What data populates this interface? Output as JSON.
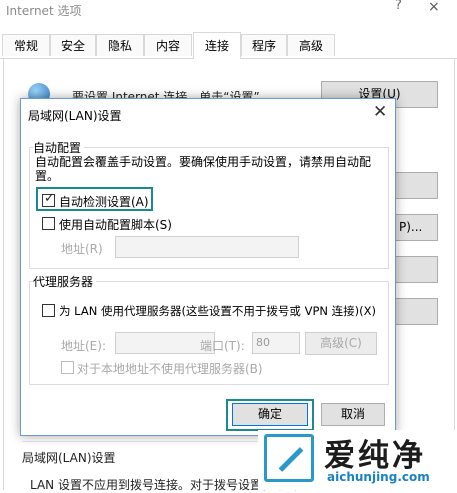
{
  "background": {
    "title": "Internet 选项",
    "help_glyph": "?",
    "close_glyph": "×",
    "tabs": [
      "常规",
      "安全",
      "隐私",
      "内容",
      "连接",
      "程序",
      "高级"
    ],
    "active_tab": "连接",
    "setup_text": "要设置 Internet 连接，单击“设置”。",
    "setup_button": "设置(U)",
    "side_buttons": [
      "",
      "",
      "P)...",
      "",
      ""
    ],
    "lan_section_label": "局域网(LAN)设置",
    "lan_section_desc": "LAN 设置不应用到拨号连接。对于拨号设置，单击"
  },
  "dialog": {
    "title": "局域网(LAN)设置",
    "close_glyph": "✕",
    "auto_config": {
      "group_label": "自动配置",
      "description": "自动配置会覆盖手动设置。要确保使用手动设置，请禁用自动配置。",
      "auto_detect": {
        "label": "自动检测设置(A)",
        "checked": true
      },
      "use_script": {
        "label": "使用自动配置脚本(S)",
        "checked": false
      },
      "address_label": "地址(R)",
      "address_value": ""
    },
    "proxy": {
      "group_label": "代理服务器",
      "use_proxy": {
        "label": "为 LAN 使用代理服务器(这些设置不用于拨号或 VPN 连接)(X)",
        "checked": false
      },
      "address_label": "地址(E):",
      "address_value": "",
      "port_label": "端口(T):",
      "port_value": "80",
      "advanced_button": "高级(C)",
      "bypass_local": {
        "label": "对于本地地址不使用代理服务器(B)",
        "checked": false
      }
    },
    "ok_button": "确定",
    "cancel_button": "取消"
  },
  "watermark": {
    "text": "爱纯净",
    "url": "aichunjing.com"
  },
  "colors": {
    "highlight": "#1a8a8f",
    "watermark_blue": "#2a98c9"
  }
}
